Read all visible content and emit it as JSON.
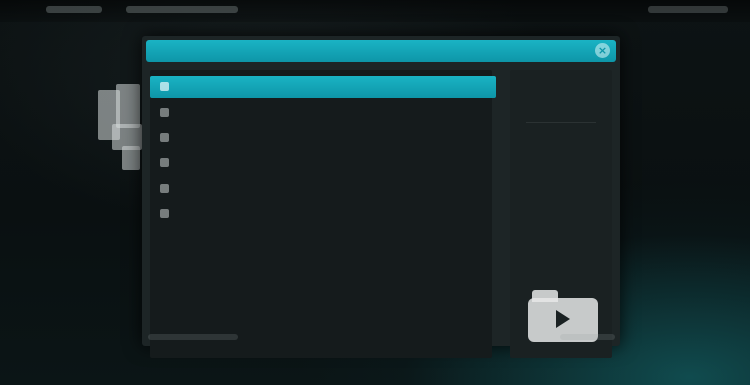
{
  "topbar": {
    "crumbs": [
      "",
      ""
    ],
    "clock": ""
  },
  "dialog": {
    "title": "",
    "close_glyph": "×",
    "items": [
      {
        "label": ""
      },
      {
        "label": ""
      },
      {
        "label": ""
      },
      {
        "label": ""
      },
      {
        "label": ""
      },
      {
        "label": ""
      }
    ],
    "selected_index": 0,
    "side_button_label": ""
  },
  "icons": {
    "side_deco": "document-stack-icon",
    "preview": "video-folder-icon"
  },
  "colors": {
    "accent": "#12a7b9",
    "panel": "#1d2526",
    "list_bg": "#151b1c"
  }
}
